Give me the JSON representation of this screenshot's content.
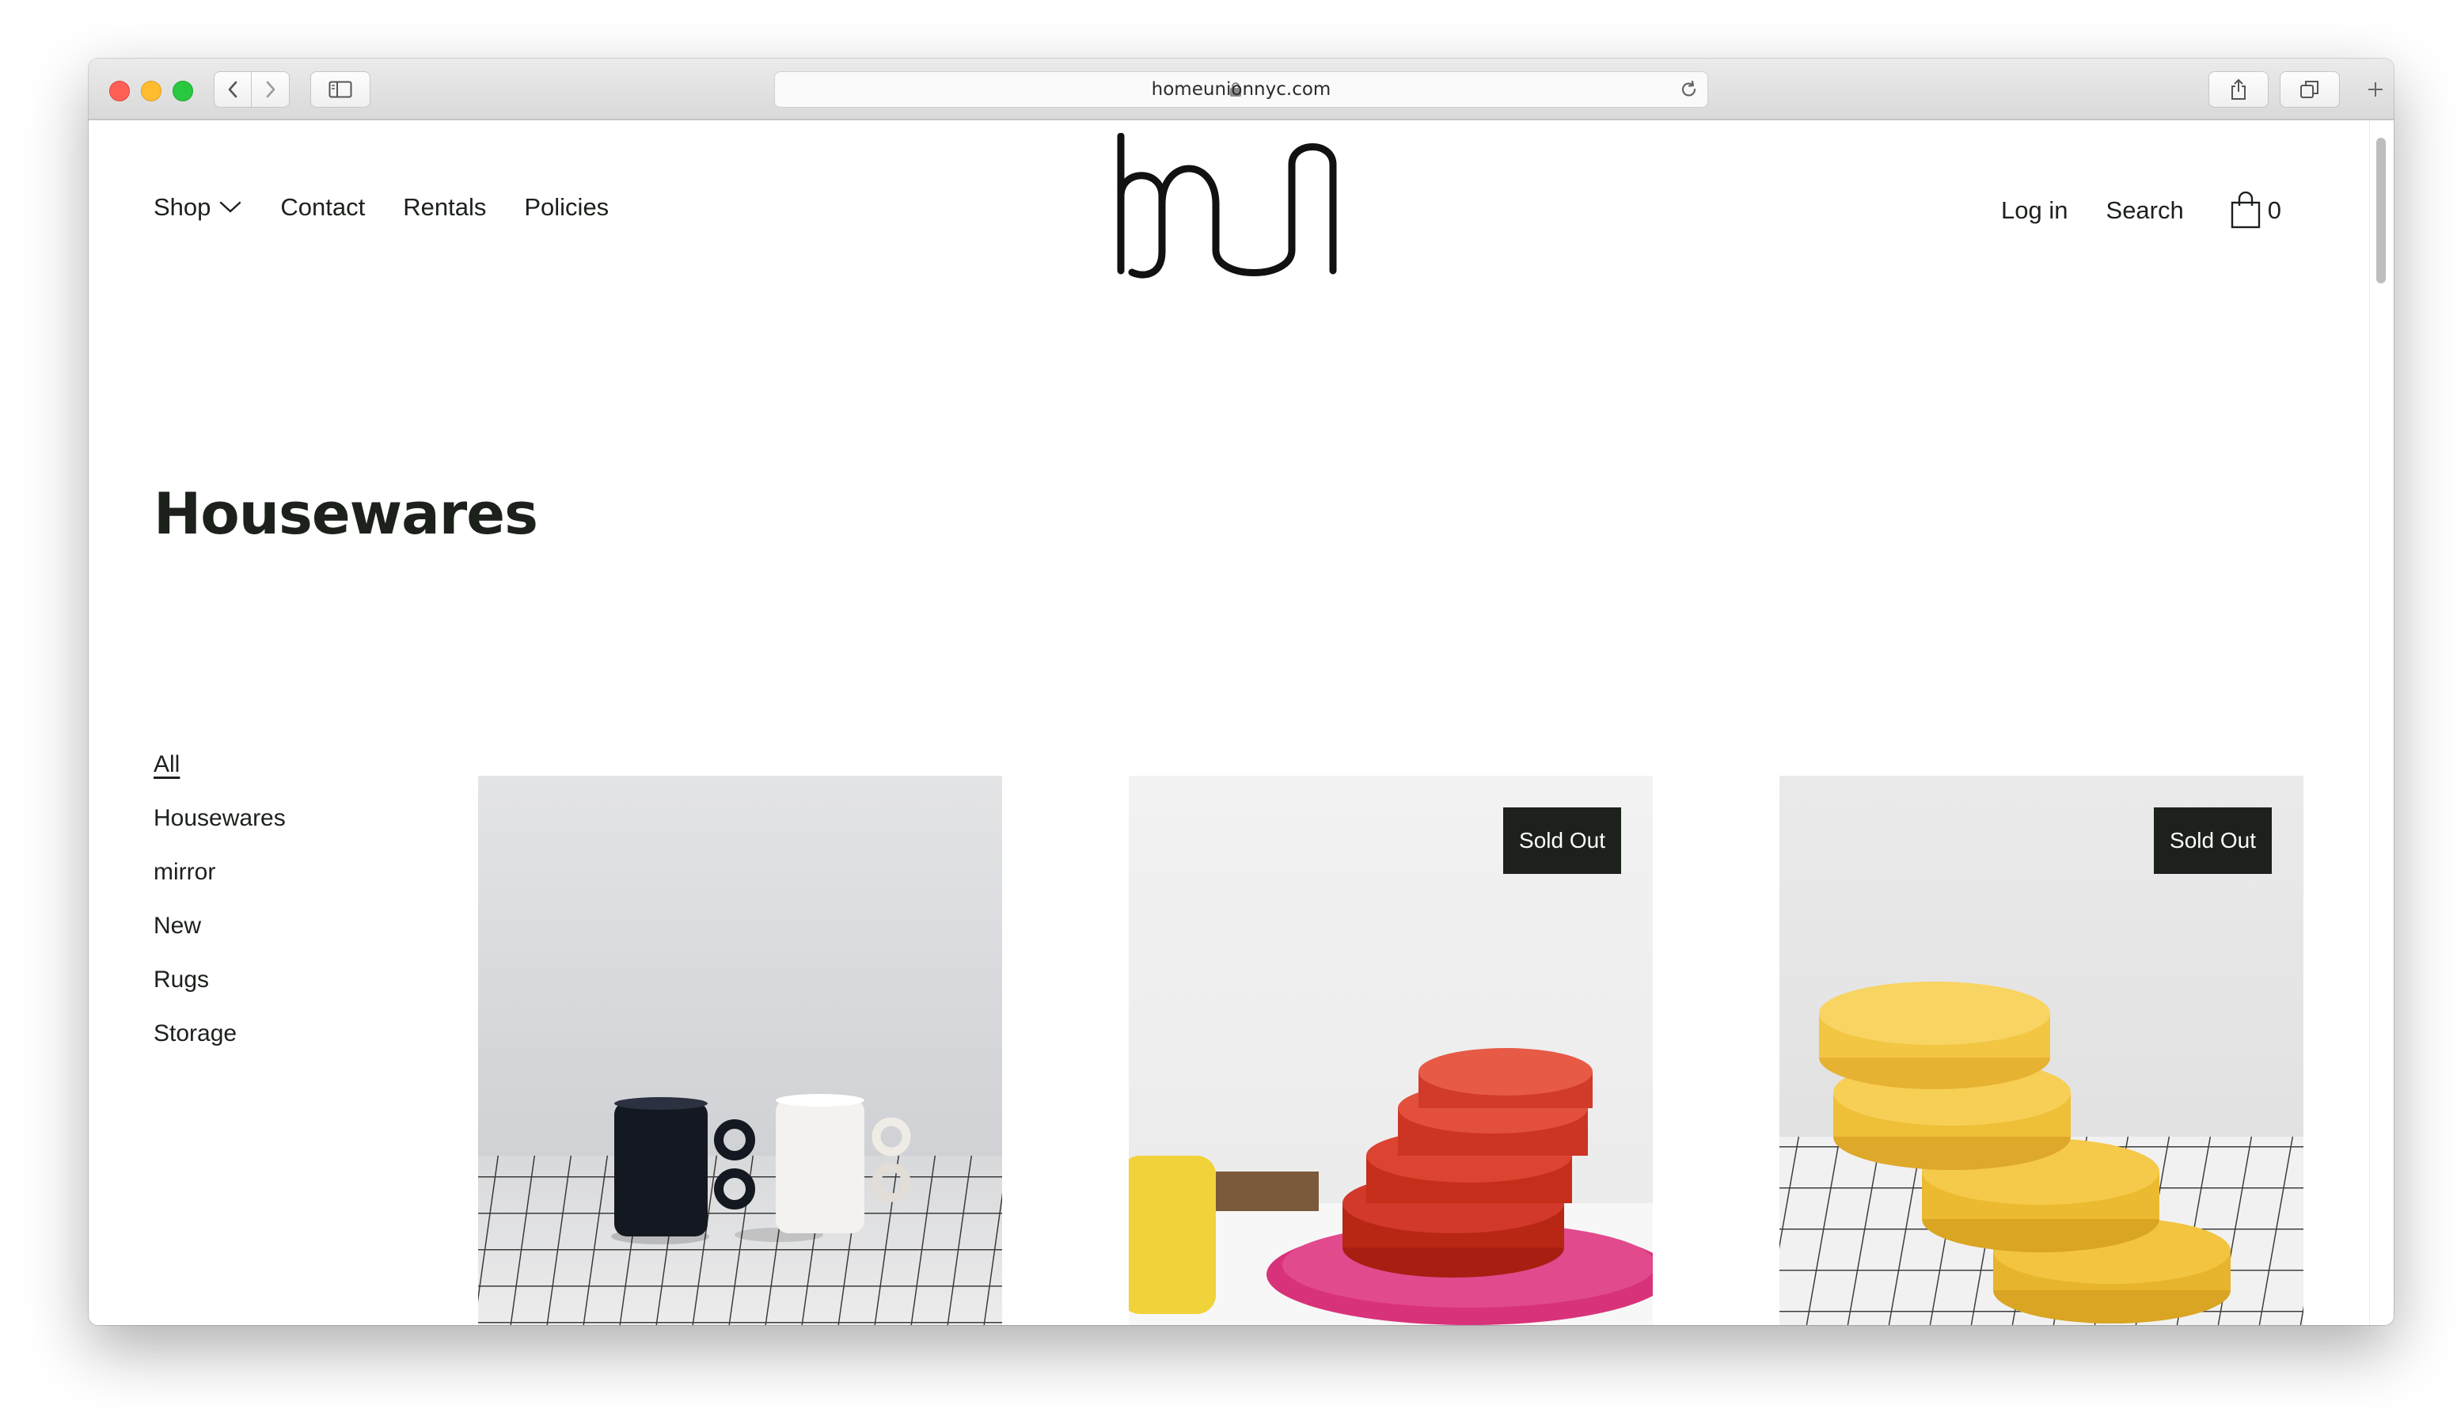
{
  "browser": {
    "url": "homeunionnyc.com",
    "tab_plus": "+"
  },
  "site": {
    "nav_left": [
      "Shop",
      "Contact",
      "Rentals",
      "Policies"
    ],
    "nav_right": {
      "login": "Log in",
      "search": "Search",
      "cart_count": "0"
    },
    "logo_text": "hu"
  },
  "page": {
    "title": "Housewares"
  },
  "filters": [
    "All",
    "Housewares",
    "mirror",
    "New",
    "Rugs",
    "Storage"
  ],
  "products": [
    {
      "badge": ""
    },
    {
      "badge": "Sold Out"
    },
    {
      "badge": "Sold Out"
    }
  ],
  "colors": {
    "text": "#1c211c",
    "badge_bg": "#1c211c"
  }
}
